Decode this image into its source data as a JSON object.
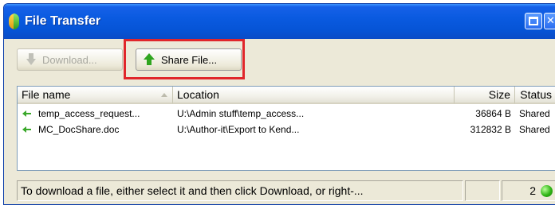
{
  "window": {
    "title": "File Transfer"
  },
  "toolbar": {
    "download_label": "Download...",
    "share_label": "Share File..."
  },
  "list": {
    "columns": [
      "File name",
      "Location",
      "Size",
      "Status"
    ],
    "rows": [
      {
        "name": "temp_access_request...",
        "location": "U:\\Admin stuff\\temp_access...",
        "size": "36864 B",
        "status": "Shared"
      },
      {
        "name": "MC_DocShare.doc",
        "location": "U:\\Author-it\\Export to Kend...",
        "size": "312832 B",
        "status": "Shared"
      }
    ]
  },
  "statusbar": {
    "message": "To download a file, either select it and then click Download, or right-...",
    "count": "2"
  },
  "colors": {
    "titlebar": "#0a5ae0",
    "highlight": "#e0262b",
    "share_icon": "#2fa51f",
    "status_indicator": "#2fb515"
  },
  "icons": {
    "app": "app-icon",
    "download": "download-arrow-icon",
    "share": "share-up-arrow-icon",
    "row": "shared-file-arrow-icon",
    "status": "connection-status-icon"
  }
}
